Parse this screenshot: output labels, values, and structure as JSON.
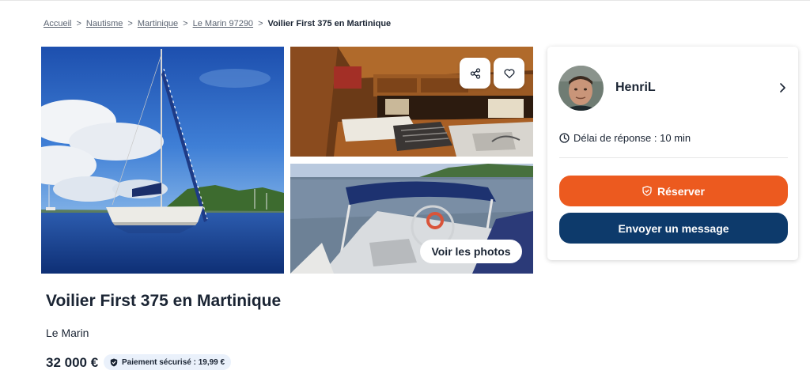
{
  "breadcrumb": {
    "items": [
      "Accueil",
      "Nautisme",
      "Martinique",
      "Le Marin 97290"
    ],
    "separator": ">",
    "current": "Voilier First 375 en Martinique"
  },
  "gallery": {
    "photos": [
      "sailboat-at-anchor",
      "cabin-interior",
      "cockpit-with-bimini"
    ],
    "view_photos_label": "Voir les photos",
    "share_icon": "share-icon",
    "favorite_icon": "heart-icon"
  },
  "listing": {
    "title": "Voilier First 375 en Martinique",
    "location": "Le Marin",
    "price": "32 000 €",
    "secure_payment": "Paiement sécurisé : 19,99 €"
  },
  "owner": {
    "name": "HenriL",
    "response_time": "Délai de réponse : 10 min"
  },
  "actions": {
    "reserve_label": "Réserver",
    "message_label": "Envoyer un message"
  },
  "colors": {
    "reserve": "#ec5a1f",
    "message": "#0d3a6b",
    "text": "#1a2433"
  }
}
